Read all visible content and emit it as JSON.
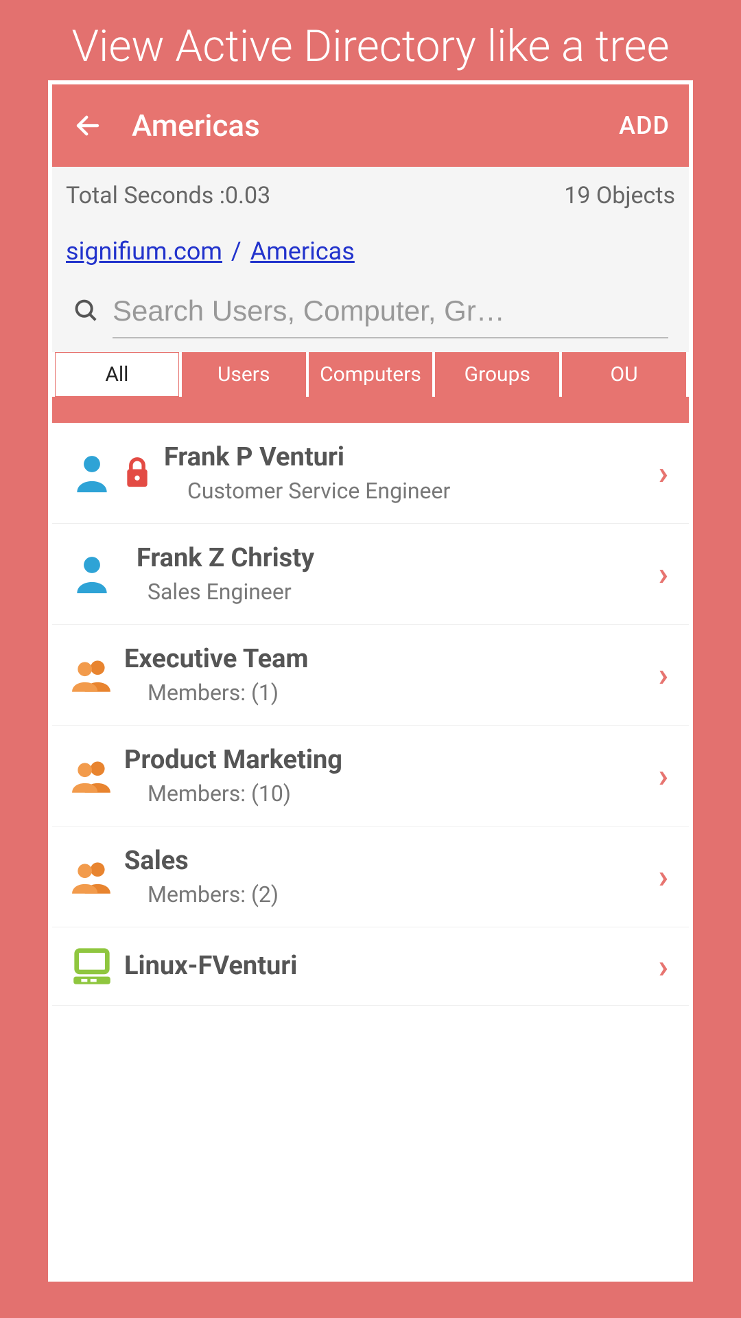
{
  "promo": {
    "title": "View Active Directory like a tree"
  },
  "appbar": {
    "title": "Americas",
    "add": "ADD"
  },
  "meta": {
    "seconds_label": "Total Seconds :0.03",
    "objects": "19 Objects"
  },
  "breadcrumb": {
    "root": "signifium.com",
    "current": "Americas"
  },
  "search": {
    "placeholder": "Search Users, Computer, Gr…"
  },
  "tabs": {
    "all": "All",
    "users": "Users",
    "computers": "Computers",
    "groups": "Groups",
    "ou": "OU"
  },
  "items": [
    {
      "type": "user",
      "locked": true,
      "title": "Frank P Venturi",
      "sub": "Customer Service Engineer"
    },
    {
      "type": "user",
      "locked": false,
      "title": "Frank Z Christy",
      "sub": "Sales Engineer"
    },
    {
      "type": "group",
      "title": "Executive Team",
      "sub": "Members: (1)"
    },
    {
      "type": "group",
      "title": "Product Marketing",
      "sub": "Members: (10)"
    },
    {
      "type": "group",
      "title": "Sales",
      "sub": "Members: (2)"
    },
    {
      "type": "computer",
      "title": "Linux-FVenturi",
      "sub": ""
    }
  ]
}
